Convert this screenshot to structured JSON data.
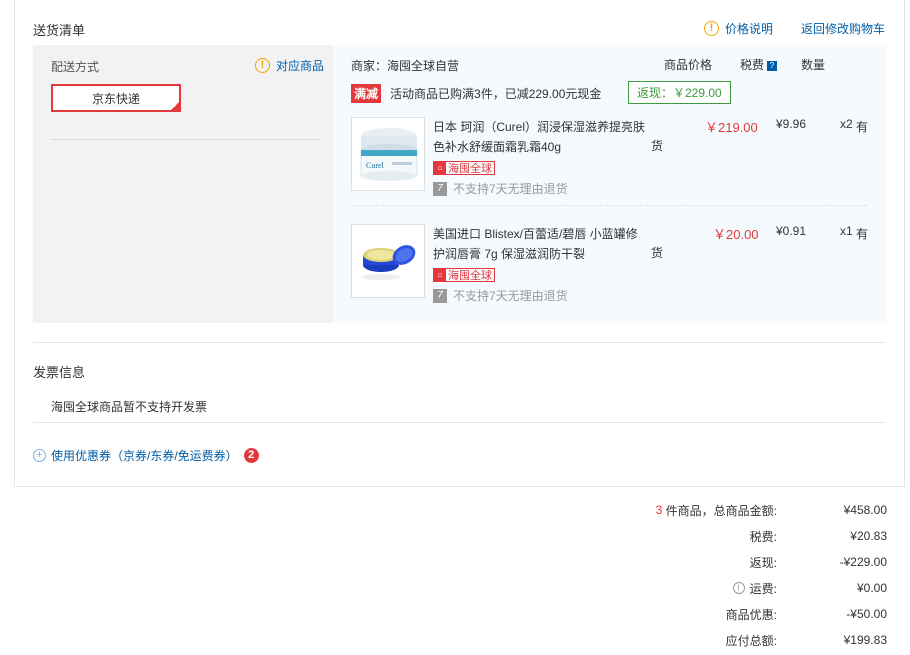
{
  "header": {
    "section_title": "送货清单",
    "price_note": "价格说明",
    "back_to_cart": "返回修改购物车"
  },
  "shipping": {
    "method_label": "配送方式",
    "goods_link": "对应商品",
    "express": "京东快递"
  },
  "merchant": {
    "label": "商家：",
    "name": "海囤全球自营"
  },
  "columns": {
    "price": "商品价格",
    "tax": "税费",
    "qty": "数量"
  },
  "promo": {
    "tag": "满减",
    "text": "活动商品已购满3件，已减229.00元现金",
    "cashback": "返现：￥229.00"
  },
  "items": [
    {
      "name": "日本 珂润（Curel）润浸保湿滋养提亮肤色补水舒缓面霜乳霜40g",
      "huo": "货",
      "tag": "海囤全球",
      "return_policy": "不支持7天无理由退货",
      "price": "￥219.00",
      "tax": "¥9.96",
      "qty": "x2",
      "stock": "有",
      "thumb_brand": "Curel"
    },
    {
      "name": "美国进口 Blistex/百蕾适/碧唇 小蓝罐修护润唇膏 7g 保湿滋润防干裂",
      "huo": "货",
      "tag": "海囤全球",
      "return_policy": "不支持7天无理由退货",
      "price": "￥20.00",
      "tax": "¥0.91",
      "qty": "x1",
      "stock": "有"
    }
  ],
  "invoice": {
    "title": "发票信息",
    "note": "海囤全球商品暂不支持开发票"
  },
  "coupon": {
    "text": "使用优惠券（京券/东券/免运费券）",
    "count": "2"
  },
  "summary": {
    "count": "3",
    "total_label": "件商品，总商品金额:",
    "total": "¥458.00",
    "tax_label": "税费:",
    "tax": "¥20.83",
    "cashback_label": "返现:",
    "cashback": "-¥229.00",
    "shipping_label": "运费:",
    "shipping": "¥0.00",
    "discount_label": "商品优惠:",
    "discount": "-¥50.00",
    "payable_label": "应付总额:",
    "payable": "¥199.83"
  },
  "icons": {
    "warn": "!",
    "plus": "+",
    "info": "!",
    "question": "?",
    "seven": "7",
    "check": "✓",
    "home": "⌂"
  },
  "colors": {
    "accent_red": "#e4393c",
    "link_blue": "#005ea7",
    "cashback_green": "#3e9a3e",
    "warn_orange": "#f0a30a"
  }
}
